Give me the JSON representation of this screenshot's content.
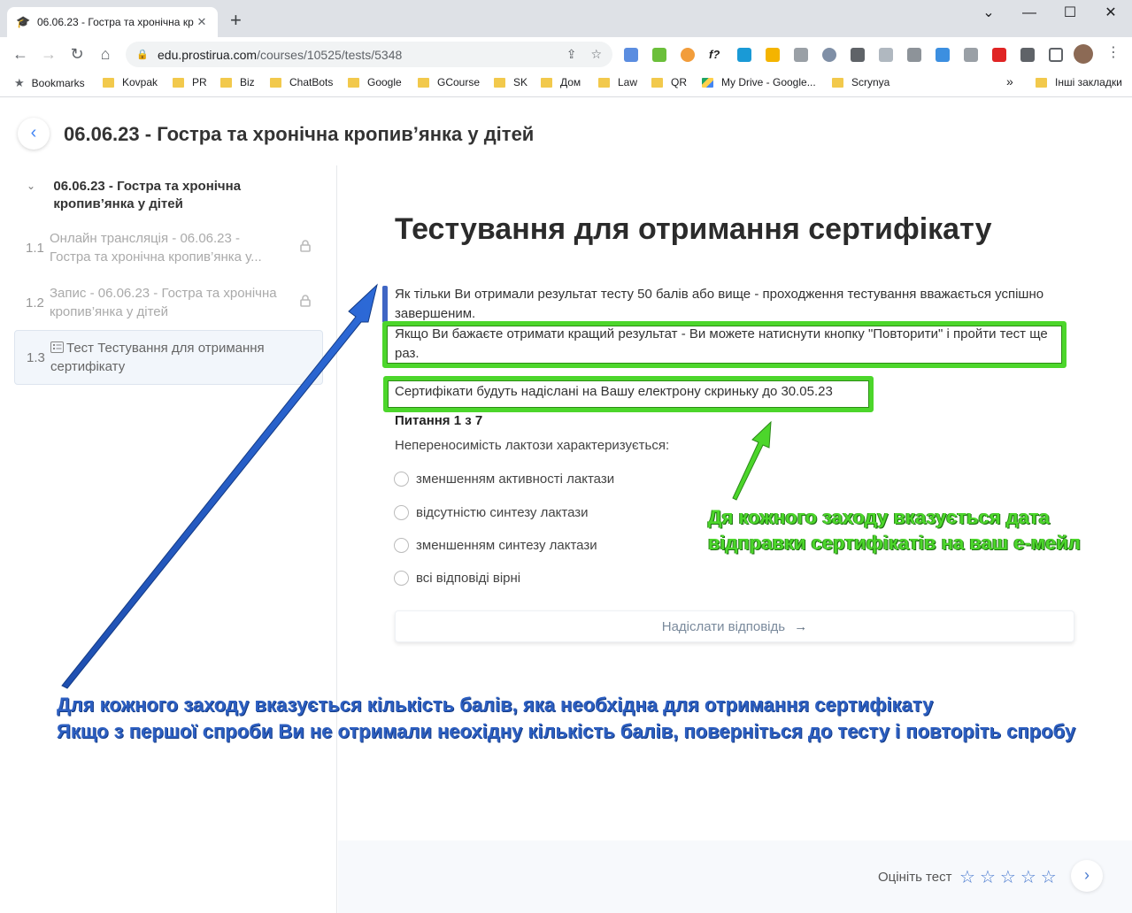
{
  "browser": {
    "tab_title": "06.06.23 - Гостра та хронічна кр",
    "url_host": "edu.prostirua.com",
    "url_path": "/courses/10525/tests/5348",
    "bookmarks": [
      "Bookmarks",
      "Kovpak",
      "PR",
      "Biz",
      "ChatBots",
      "Google",
      "GCourse",
      "SK",
      "Дом",
      "Law",
      "QR",
      "My Drive - Google...",
      "Scrynya"
    ],
    "bookmarks_more": "»",
    "other_bookmarks": "Інші закладки"
  },
  "header": {
    "title": "06.06.23 - Гостра та хронічна кропив’янка у дітей"
  },
  "sidebar": {
    "section_title": "06.06.23 - Гостра та хронічна кропив’янка у дітей",
    "items": [
      {
        "num": "1.1",
        "label": "Онлайн трансляція - 06.06.23 - Гостра та хронічна кропив’янка у...",
        "locked": true
      },
      {
        "num": "1.2",
        "label": "Запис - 06.06.23 - Гостра та хронічна кропив’янка у дітей",
        "locked": true
      },
      {
        "num": "1.3",
        "prefix": "Тест",
        "label": "Тестування для отримання сертифікату",
        "locked": false
      }
    ]
  },
  "test": {
    "title": "Тестування для отримання сертифікату",
    "info_line1": "Як тільки Ви отримали результат тесту 50 балів або вище - проходження тестування вважається успішно завершеним.",
    "info_line2": "Якщо Ви бажаєте отримати кращий результат - Ви можете натиснути кнопку \"Повторити\" і пройти тест ще раз.",
    "certificate_note": "Сертифікати будуть надіслані на Вашу електрону скриньку до 30.05.23",
    "question_number": "Питання 1 з 7",
    "question_text": "Непереносимість лактози характеризується:",
    "options": [
      "зменшенням активності лактази",
      "відсутністю синтезу лактази",
      "зменшенням синтезу лактази",
      "всі відповіді вірні"
    ],
    "submit_label": "Надіслати відповідь"
  },
  "footer": {
    "rate_label": "Оцініть тест",
    "stars": 5
  },
  "annotations": {
    "green_line1": "Дя кожного заходу вказується дата",
    "green_line2": "відправки сертифікатів на ваш е-мейл",
    "blue_line1": "Для кожного заходу вказується кількість балів, яка необхідна для отримання сертифікату",
    "blue_line2": "Якщо з першої спроби Ви не отримали неохідну кількість балів, поверніться до тесту і повторіть спробу"
  },
  "colors": {
    "accent_blue": "#4a7bd0",
    "highlight_green": "#4cd62b",
    "annotation_blue": "#2d5fc1"
  }
}
